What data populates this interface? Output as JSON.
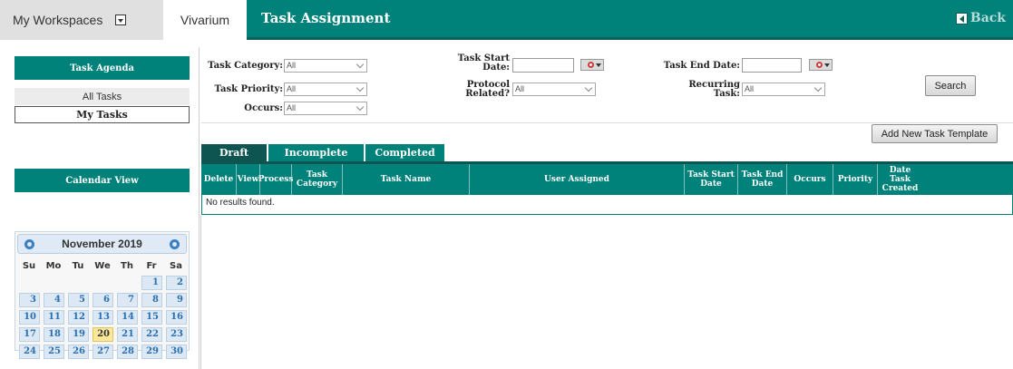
{
  "header": {
    "workspaces_label": "My Workspaces",
    "app_name": "Vivarium",
    "page_title": "Task Assignment",
    "back_label": "Back"
  },
  "sidebar": {
    "agenda_title": "Task Agenda",
    "items": [
      {
        "label": "All Tasks"
      },
      {
        "label": "My Tasks"
      }
    ],
    "calendar_title": "Calendar View",
    "calendar": {
      "month_label": "November 2019",
      "weekdays": [
        "Su",
        "Mo",
        "Tu",
        "We",
        "Th",
        "Fr",
        "Sa"
      ],
      "today": "20",
      "rows": [
        [
          "",
          "",
          "",
          "",
          "",
          "1",
          "2"
        ],
        [
          "3",
          "4",
          "5",
          "6",
          "7",
          "8",
          "9"
        ],
        [
          "10",
          "11",
          "12",
          "13",
          "14",
          "15",
          "16"
        ],
        [
          "17",
          "18",
          "19",
          "20",
          "21",
          "22",
          "23"
        ],
        [
          "24",
          "25",
          "26",
          "27",
          "28",
          "29",
          "30"
        ]
      ]
    }
  },
  "filters": {
    "task_category_label": "Task Category:",
    "task_category_value": "All",
    "task_priority_label": "Task Priority:",
    "task_priority_value": "All",
    "occurs_label": "Occurs:",
    "occurs_value": "All",
    "start_date_label_1": "Task Start",
    "start_date_label_2": "Date:",
    "start_date_value": "",
    "protocol_label_1": "Protocol",
    "protocol_label_2": "Related?",
    "protocol_value": "All",
    "end_date_label": "Task End Date:",
    "end_date_value": "",
    "recurring_label_1": "Recurring",
    "recurring_label_2": "Task:",
    "recurring_value": "All",
    "search_label": "Search",
    "add_template_label": "Add New Task Template"
  },
  "tabs": [
    {
      "label": "Draft",
      "active": true
    },
    {
      "label": "Incomplete",
      "active": false
    },
    {
      "label": "Completed",
      "active": false
    }
  ],
  "table": {
    "columns": [
      {
        "line1": "Delete",
        "line2": ""
      },
      {
        "line1": "View",
        "line2": ""
      },
      {
        "line1": "Process",
        "line2": ""
      },
      {
        "line1": "Task",
        "line2": "Category"
      },
      {
        "line1": "Task Name",
        "line2": ""
      },
      {
        "line1": "User Assigned",
        "line2": ""
      },
      {
        "line1": "Task Start",
        "line2": "Date"
      },
      {
        "line1": "Task End",
        "line2": "Date"
      },
      {
        "line1": "Occurs",
        "line2": ""
      },
      {
        "line1": "Priority",
        "line2": ""
      },
      {
        "line1": "Date Task",
        "line2": "Created"
      }
    ],
    "empty_message": "No results found."
  },
  "colors": {
    "accent": "#00817a",
    "accent_dark": "#0e5450",
    "today": "#fbe89a"
  }
}
